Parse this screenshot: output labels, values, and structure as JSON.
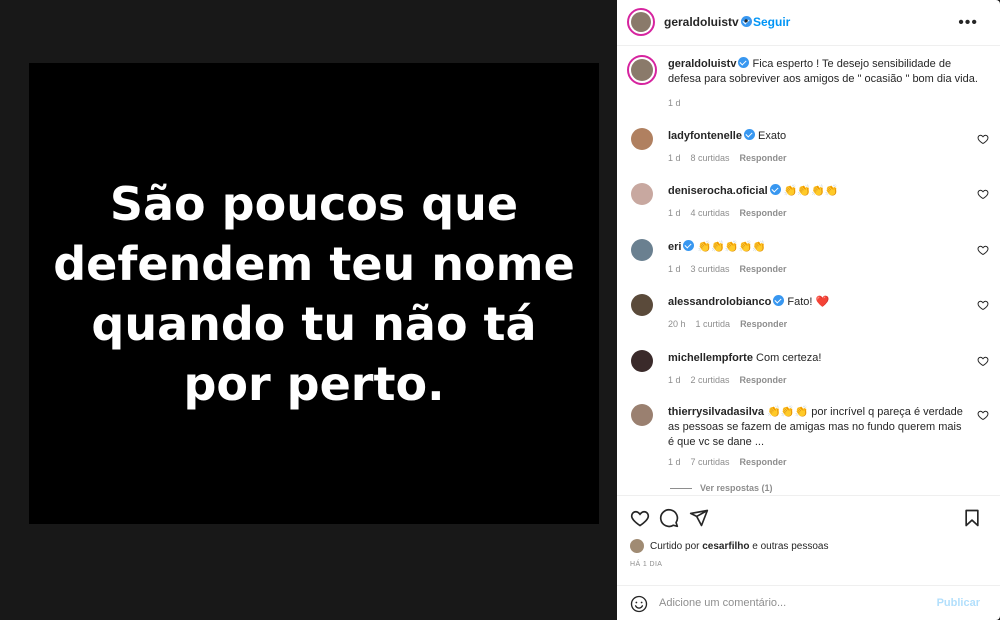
{
  "media": {
    "text": "São poucos que defendem teu nome quando tu não tá por perto."
  },
  "header": {
    "username": "geraldoluistv",
    "separator": "•",
    "follow_label": "Seguir",
    "more_label": "•••"
  },
  "caption": {
    "username": "geraldoluistv",
    "text": "Fica esperto ! Te desejo sensibilidade de defesa para sobreviver aos amigos de \" ocasião \" bom dia vida.",
    "time": "1 d"
  },
  "comments": [
    {
      "username": "ladyfontenelle",
      "verified": true,
      "text": "Exato",
      "time": "1 d",
      "likes": "8 curtidas",
      "reply": "Responder",
      "avatar_color": "#b08060"
    },
    {
      "username": "deniserocha.oficial",
      "verified": true,
      "text": "👏👏👏👏",
      "time": "1 d",
      "likes": "4 curtidas",
      "reply": "Responder",
      "avatar_color": "#c8a8a0"
    },
    {
      "username": "eri",
      "verified": true,
      "text": "👏👏👏👏👏",
      "time": "1 d",
      "likes": "3 curtidas",
      "reply": "Responder",
      "avatar_color": "#6a8090"
    },
    {
      "username": "alessandrolobianco",
      "verified": true,
      "text": "Fato! ❤️",
      "time": "20 h",
      "likes": "1 curtida",
      "reply": "Responder",
      "avatar_color": "#5a4a3a"
    },
    {
      "username": "michellempforte",
      "verified": false,
      "text": "Com certeza!",
      "time": "1 d",
      "likes": "2 curtidas",
      "reply": "Responder",
      "avatar_color": "#3a2a2a"
    },
    {
      "username": "thierrysilvadasilva",
      "verified": false,
      "text": "👏👏👏 por incrível q pareça é verdade as pessoas se fazem de amigas mas no fundo querem mais é que vc se dane ...",
      "time": "1 d",
      "likes": "7 curtidas",
      "reply": "Responder",
      "avatar_color": "#9a8070"
    }
  ],
  "view_replies": "Ver respostas (1)",
  "liked_by": {
    "prefix": "Curtido por",
    "user": "cesarfilho",
    "suffix": "e outras pessoas"
  },
  "time_ago": "HÁ 1 DIA",
  "add_comment": {
    "placeholder": "Adicione um comentário...",
    "publish_label": "Publicar"
  },
  "colors": {
    "accent": "#0095f6",
    "verified": "#3897f0",
    "heart_red": "#ed4956",
    "publish_disabled": "#b2dffc"
  }
}
